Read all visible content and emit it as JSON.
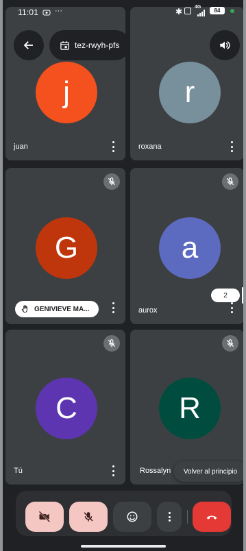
{
  "status_bar": {
    "time": "11:01",
    "network": "4G",
    "battery": "84"
  },
  "header": {
    "meeting_code": "tez-rwyh-pfs"
  },
  "participants": [
    {
      "name": "juan",
      "initial": "j",
      "color": "#f4511e"
    },
    {
      "name": "roxana",
      "initial": "r",
      "color": "#78909c"
    },
    {
      "name": "GENIVIEVE MA...",
      "initial": "G",
      "color": "#bf360c"
    },
    {
      "name": "aurox",
      "initial": "a",
      "color": "#5c6bc0"
    },
    {
      "name": "Tú",
      "initial": "C",
      "color": "#5e35b1"
    },
    {
      "name": "Rossalyn",
      "initial": "R",
      "color": "#004d40"
    }
  ],
  "scroll_badge": "2",
  "toast": "Volver al principio",
  "colors": {
    "end_call": "#e53935",
    "control_off": "#f4c7c3",
    "control_dark": "#3c4043"
  }
}
